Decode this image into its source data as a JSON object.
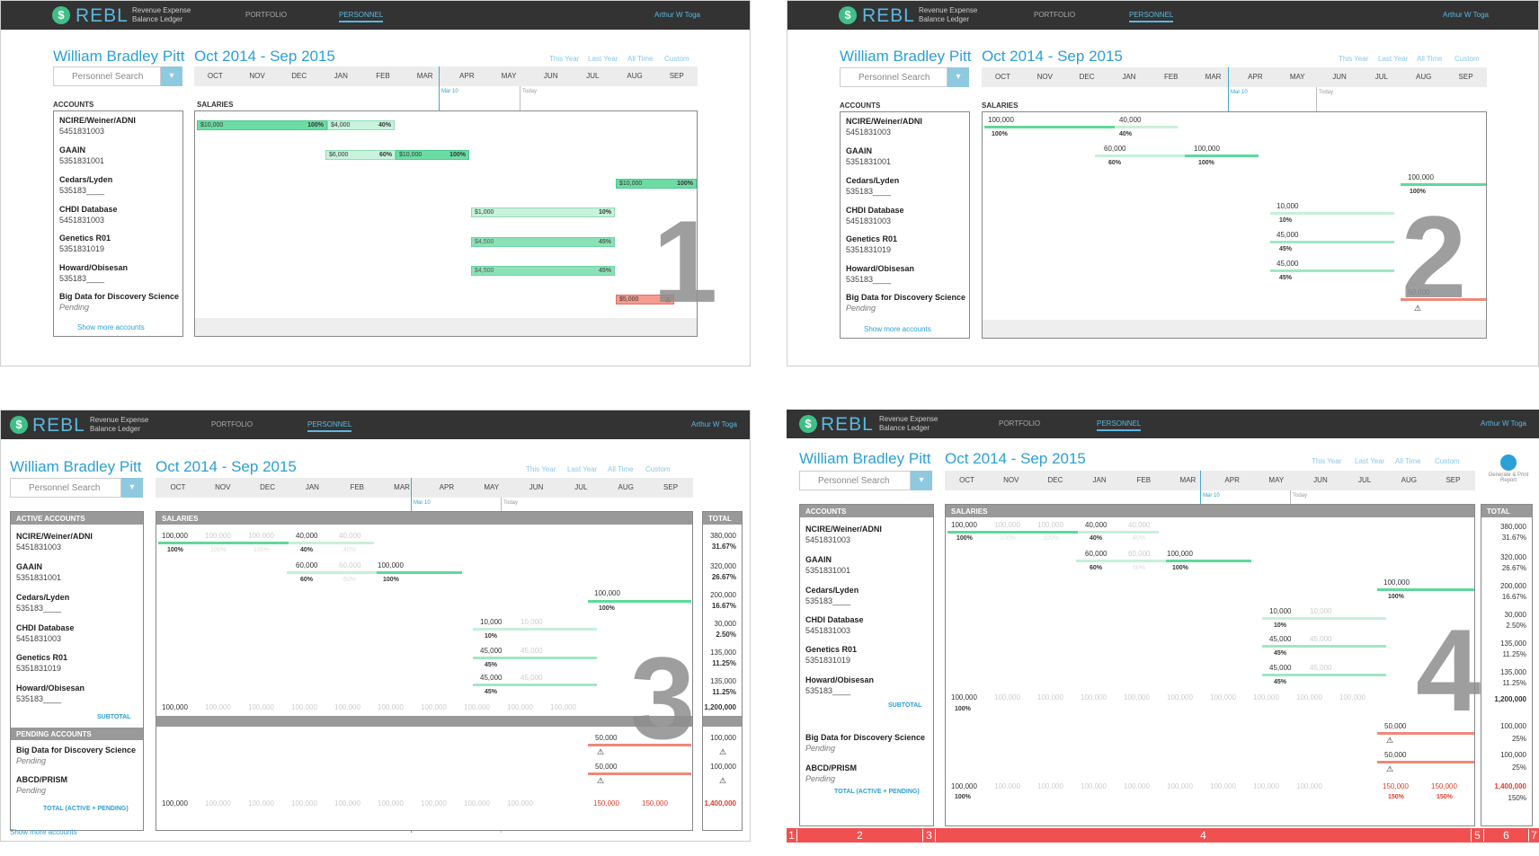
{
  "app": {
    "brand": "REBL",
    "tagline": "Revenue Expense Balance Ledger",
    "nav_portfolio": "PORTFOLIO",
    "nav_personnel": "PERSONNEL",
    "user": "Arthur W Toga"
  },
  "person": "William Bradley Pitt",
  "period": "Oct 2014 - Sep 2015",
  "ranges": [
    "This Year",
    "Last Year",
    "All Time",
    "Custom"
  ],
  "search_placeholder": "Personnel Search",
  "months": [
    "OCT",
    "NOV",
    "DEC",
    "JAN",
    "FEB",
    "MAR",
    "APR",
    "MAY",
    "JUN",
    "JUL",
    "AUG",
    "SEP"
  ],
  "year_start": "2014",
  "year_mid": "2015",
  "markers": {
    "mar10": "Mar 10",
    "today": "Today"
  },
  "labels": {
    "accounts": "ACCOUNTS",
    "salaries": "SALARIES",
    "active": "ACTIVE ACCOUNTS",
    "pending": "PENDING ACCOUNTS",
    "total": "TOTAL",
    "subtotal": "SUBTOTAL",
    "grand": "TOTAL (ACTIVE + PENDING)",
    "show_more": "Show more accounts",
    "generate": "Generate & Print Report"
  },
  "accounts": [
    {
      "name": "NCIRE/Weiner/ADNI",
      "num": "5451831003"
    },
    {
      "name": "GAAIN",
      "num": "5351831001"
    },
    {
      "name": "Cedars/Lyden",
      "num": "535183____"
    },
    {
      "name": "CHDI Database",
      "num": "5451831003"
    },
    {
      "name": "Genetics R01",
      "num": "5351831019"
    },
    {
      "name": "Howard/Obisesan",
      "num": "535183____"
    }
  ],
  "pending_accounts": [
    {
      "name": "Big Data for Discovery Science",
      "status": "Pending"
    },
    {
      "name": "ABCD/PRISM",
      "status": "Pending"
    }
  ],
  "p1_bars": {
    "a1": "$10,000",
    "a1p": "100%",
    "a1b": "$4,000",
    "a1bp": "40%",
    "a2": "$6,000",
    "a2p": "60%",
    "a2b": "$10,000",
    "a2bp": "100%",
    "a3": "$10,000",
    "a3p": "100%",
    "a4": "$1,000",
    "a4p": "10%",
    "a5": "$4,500",
    "a5p": "45%",
    "a6": "$4,500",
    "a6p": "45%",
    "a7": "$5,000"
  },
  "values": {
    "v100000": "100,000",
    "v40000": "40,000",
    "v60000": "60,000",
    "v10000": "10,000",
    "v45000": "45,000",
    "v50000": "50,000",
    "v150000": "150,000",
    "p100": "100%",
    "p40": "40%",
    "p60": "60%",
    "p10": "10%",
    "p45": "45%",
    "p25": "25%",
    "p150": "150%"
  },
  "totals": [
    {
      "v": "380,000",
      "p": "31.67%"
    },
    {
      "v": "320,000",
      "p": "26.67%"
    },
    {
      "v": "200,000",
      "p": "16.67%"
    },
    {
      "v": "30,000",
      "p": "2.50%"
    },
    {
      "v": "135,000",
      "p": "11.25%"
    },
    {
      "v": "135,000",
      "p": "11.25%"
    }
  ],
  "subtotal": "1,200,000",
  "pending_totals": [
    "100,000",
    "100,000"
  ],
  "grand_total": "1,400,000",
  "step_numbers": [
    "1",
    "2",
    "3",
    "4"
  ],
  "strip": [
    "1",
    "2",
    "3",
    "4",
    "5",
    "6",
    "7"
  ]
}
